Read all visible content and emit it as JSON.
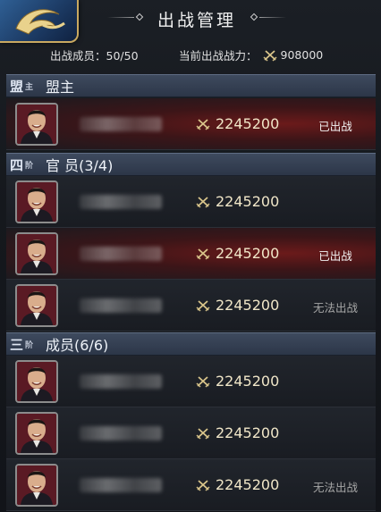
{
  "header": {
    "title": "出战管理",
    "members_label": "出战成员：50/50",
    "power_label": "当前出战战力：",
    "power_value": "908000"
  },
  "sections": [
    {
      "badge_big": "盟",
      "badge_small": "主",
      "label": "盟主"
    },
    {
      "badge_big": "四",
      "badge_small": "阶",
      "label": "官 员(3/4)"
    },
    {
      "badge_big": "三",
      "badge_small": "阶",
      "label": "成员(6/6)"
    }
  ],
  "rows": [
    {
      "power": "2245200",
      "status": "已出战",
      "state": "deployed"
    },
    {
      "power": "2245200",
      "status": "",
      "state": "normal"
    },
    {
      "power": "2245200",
      "status": "已出战",
      "state": "deployed"
    },
    {
      "power": "2245200",
      "status": "无法出战",
      "state": "unable"
    },
    {
      "power": "2245200",
      "status": "",
      "state": "normal"
    },
    {
      "power": "2245200",
      "status": "",
      "state": "normal"
    },
    {
      "power": "2245200",
      "status": "无法出战",
      "state": "unable"
    }
  ],
  "colors": {
    "deployed_row": "#6b1a1a",
    "section_bg": "#3e4a5e",
    "power_text": "#f0e6c8"
  },
  "icons": {
    "power": "crossed-swords-icon",
    "emblem": "dragon-emblem-icon",
    "avatar": "portrait-avatar-icon"
  }
}
